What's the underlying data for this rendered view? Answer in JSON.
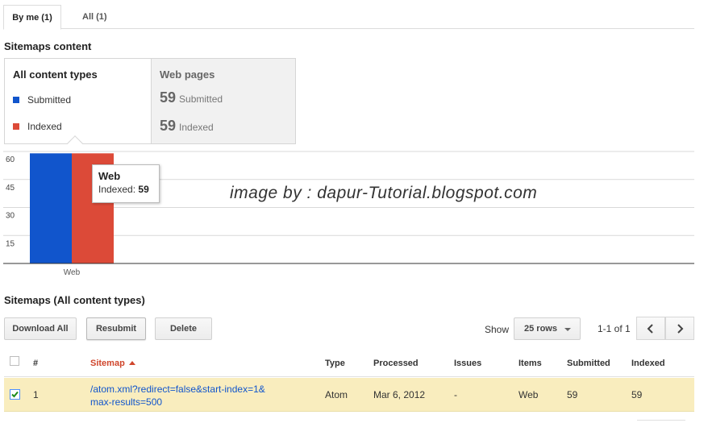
{
  "tabs": {
    "by_me": "By me (1)",
    "all": "All (1)"
  },
  "content_section_title": "Sitemaps content",
  "summary": {
    "all_types_title": "All content types",
    "legend_submitted": "Submitted",
    "legend_indexed": "Indexed",
    "web_pages_title": "Web pages",
    "submitted_count": "59",
    "submitted_label": "Submitted",
    "indexed_count": "59",
    "indexed_label": "Indexed"
  },
  "colors": {
    "submitted": "#1155cc",
    "indexed": "#dc4a38",
    "row_selected": "#f9edbe",
    "sort_active": "#d0462c",
    "link": "#1155cc"
  },
  "chart_data": {
    "type": "bar",
    "categories": [
      "Web"
    ],
    "series": [
      {
        "name": "Submitted",
        "values": [
          59
        ]
      },
      {
        "name": "Indexed",
        "values": [
          59
        ]
      }
    ],
    "y_ticks": [
      "15",
      "30",
      "45",
      "60"
    ],
    "ylim": [
      0,
      60
    ],
    "grid": true
  },
  "tooltip": {
    "title": "Web",
    "label": "Indexed:",
    "value": "59"
  },
  "watermark": "image by : dapur-Tutorial.blogspot.com",
  "list_section_title": "Sitemaps (All content types)",
  "toolbar": {
    "download_all": "Download All",
    "resubmit": "Resubmit",
    "delete": "Delete",
    "show_label": "Show",
    "rows_selected": "25 rows",
    "pager_text": "1-1 of 1"
  },
  "table": {
    "headers": {
      "num": "#",
      "sitemap": "Sitemap",
      "type": "Type",
      "processed": "Processed",
      "issues": "Issues",
      "items": "Items",
      "submitted": "Submitted",
      "indexed": "Indexed"
    },
    "rows": [
      {
        "num": "1",
        "sitemap_line1": "/atom.xml?redirect=false&start-index=1&",
        "sitemap_line2": "max-results=500",
        "type": "Atom",
        "processed": "Mar 6, 2012",
        "issues": "-",
        "items": "Web",
        "submitted": "59",
        "indexed": "59"
      }
    ]
  }
}
